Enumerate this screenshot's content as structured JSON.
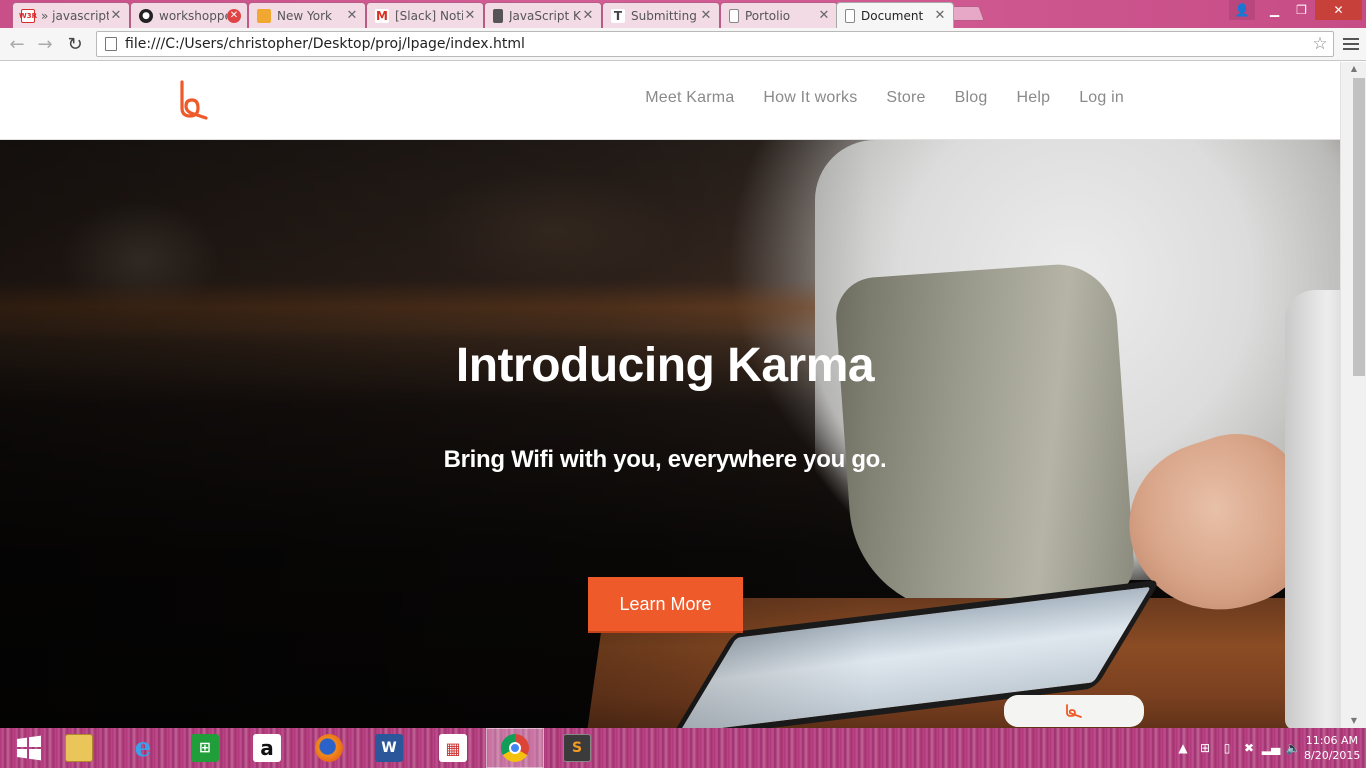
{
  "browser": {
    "tabs": [
      {
        "label": "» javascript",
        "favicon": "w3r-icon",
        "fav_color": "#d52b2b"
      },
      {
        "label": "workshoppe",
        "favicon": "github-icon",
        "fav_color": "#222222"
      },
      {
        "label": "New York",
        "favicon": "box-icon",
        "fav_color": "#f0a830"
      },
      {
        "label": "[Slack] Noti",
        "favicon": "gmail-icon",
        "fav_color": "#d93025"
      },
      {
        "label": "JavaScript K",
        "favicon": "doc-icon",
        "fav_color": "#555555"
      },
      {
        "label": "Submitting",
        "favicon": "table-icon",
        "fav_color": "#555555"
      },
      {
        "label": "Portolio",
        "favicon": "page-icon",
        "fav_color": "#888888"
      },
      {
        "label": "Document",
        "favicon": "page-icon",
        "fav_color": "#888888",
        "active": true
      }
    ],
    "address": "file:///C:/Users/christopher/Desktop/proj/lpage/index.html"
  },
  "site": {
    "brand_color": "#ee5a2a",
    "nav": [
      "Meet Karma",
      "How It works",
      "Store",
      "Blog",
      "Help",
      "Log in"
    ],
    "hero": {
      "title": "Introducing Karma",
      "subtitle": "Bring Wifi with you, everywhere you go.",
      "cta": "Learn More"
    }
  },
  "taskbar": {
    "apps": [
      "windows-start-icon",
      "file-explorer-icon",
      "internet-explorer-icon",
      "store-icon",
      "amazon-icon",
      "firefox-icon",
      "word-icon",
      "apps-grid-icon",
      "chrome-icon",
      "sublime-text-icon"
    ],
    "time": "11:06 AM",
    "date": "8/20/2015"
  }
}
